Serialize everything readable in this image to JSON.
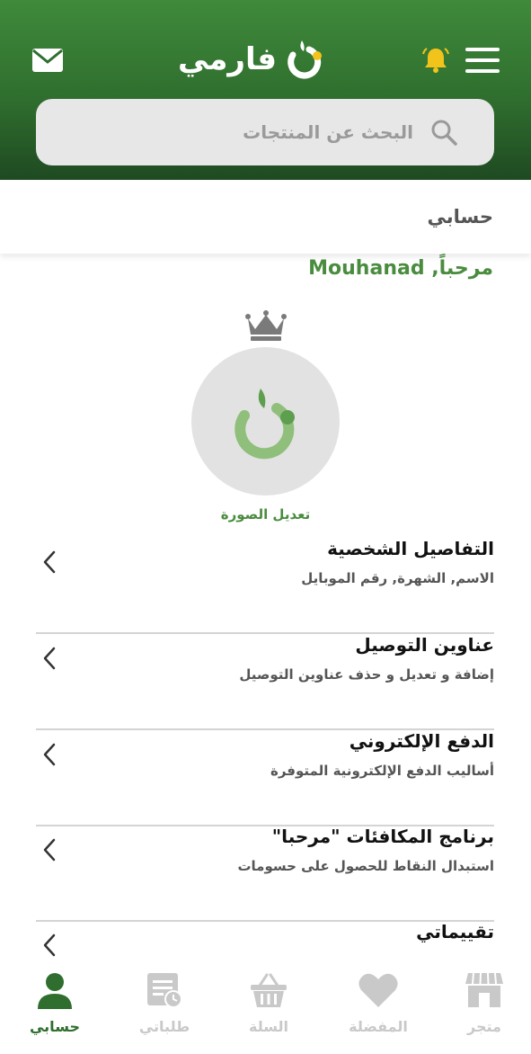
{
  "header": {
    "logo_text": "فارمي",
    "search_placeholder": "البحث عن المنتجات",
    "colors": {
      "header_green": "#2f6e2e",
      "bell_yellow": "#f2c41b",
      "accent_green": "#4a8c3f"
    }
  },
  "page": {
    "title": "حسابي",
    "greeting": "مرحباً, Mouhanad",
    "edit_photo_label": "تعديل الصورة"
  },
  "menu": [
    {
      "title": "التفاصيل الشخصية",
      "subtitle": "الاسم, الشهرة, رقم الموبايل"
    },
    {
      "title": "عناوين التوصيل",
      "subtitle": "إضافة و تعديل و حذف عناوين التوصيل"
    },
    {
      "title": "الدفع الإلكتروني",
      "subtitle": "أساليب الدفع الإلكترونية المتوفرة"
    },
    {
      "title": "برنامج المكافئات \"مرحبا\"",
      "subtitle": "استبدال النقاط للحصول على حسومات"
    },
    {
      "title": "تقييماتي",
      "subtitle": ""
    }
  ],
  "bottom_nav": [
    {
      "label": "حسابي",
      "icon": "person-icon",
      "active": true
    },
    {
      "label": "طلباتي",
      "icon": "orders-icon",
      "active": false
    },
    {
      "label": "السلة",
      "icon": "basket-icon",
      "active": false
    },
    {
      "label": "المفضلة",
      "icon": "heart-icon",
      "active": false
    },
    {
      "label": "متجر",
      "icon": "store-icon",
      "active": false
    }
  ]
}
